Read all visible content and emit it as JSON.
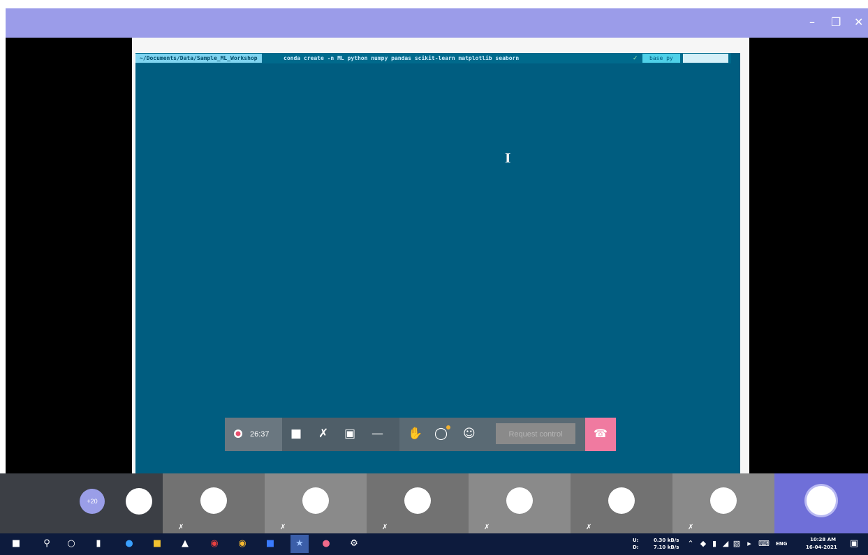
{
  "window": {
    "minimize_icon": "minimize-icon",
    "maximize_icon": "maximize-icon",
    "close_icon": "close-icon"
  },
  "terminal": {
    "path": "~/Documents/Data/Sample_ML_Workshop",
    "command": "conda create -n ML python numpy pandas scikit-learn matplotlib seaborn",
    "env": "base py",
    "cursor_icon": "text-cursor-icon"
  },
  "call_controls": {
    "timer": "26:37",
    "request_control": "Request control",
    "icons": [
      "recording-icon",
      "video-camera-icon",
      "microphone-off-icon",
      "share-screen-icon",
      "more-icon",
      "raise-hand-icon",
      "chat-icon",
      "participants-icon",
      "hang-up-icon"
    ]
  },
  "participants": {
    "count_badge": "+20"
  },
  "taskbar": {
    "network_up_label": "U:",
    "network_down_label": "D:",
    "network_up": "0.30 kB/s",
    "network_down": "7.10 kB/s",
    "language": "ENG",
    "time": "10:28 AM",
    "date": "16-04-2021"
  },
  "colors": {
    "titlebar": "#9b9ce9",
    "terminal_bg": "#005d80",
    "hangup": "#f07aa0",
    "taskbar": "#0d1b3d"
  }
}
